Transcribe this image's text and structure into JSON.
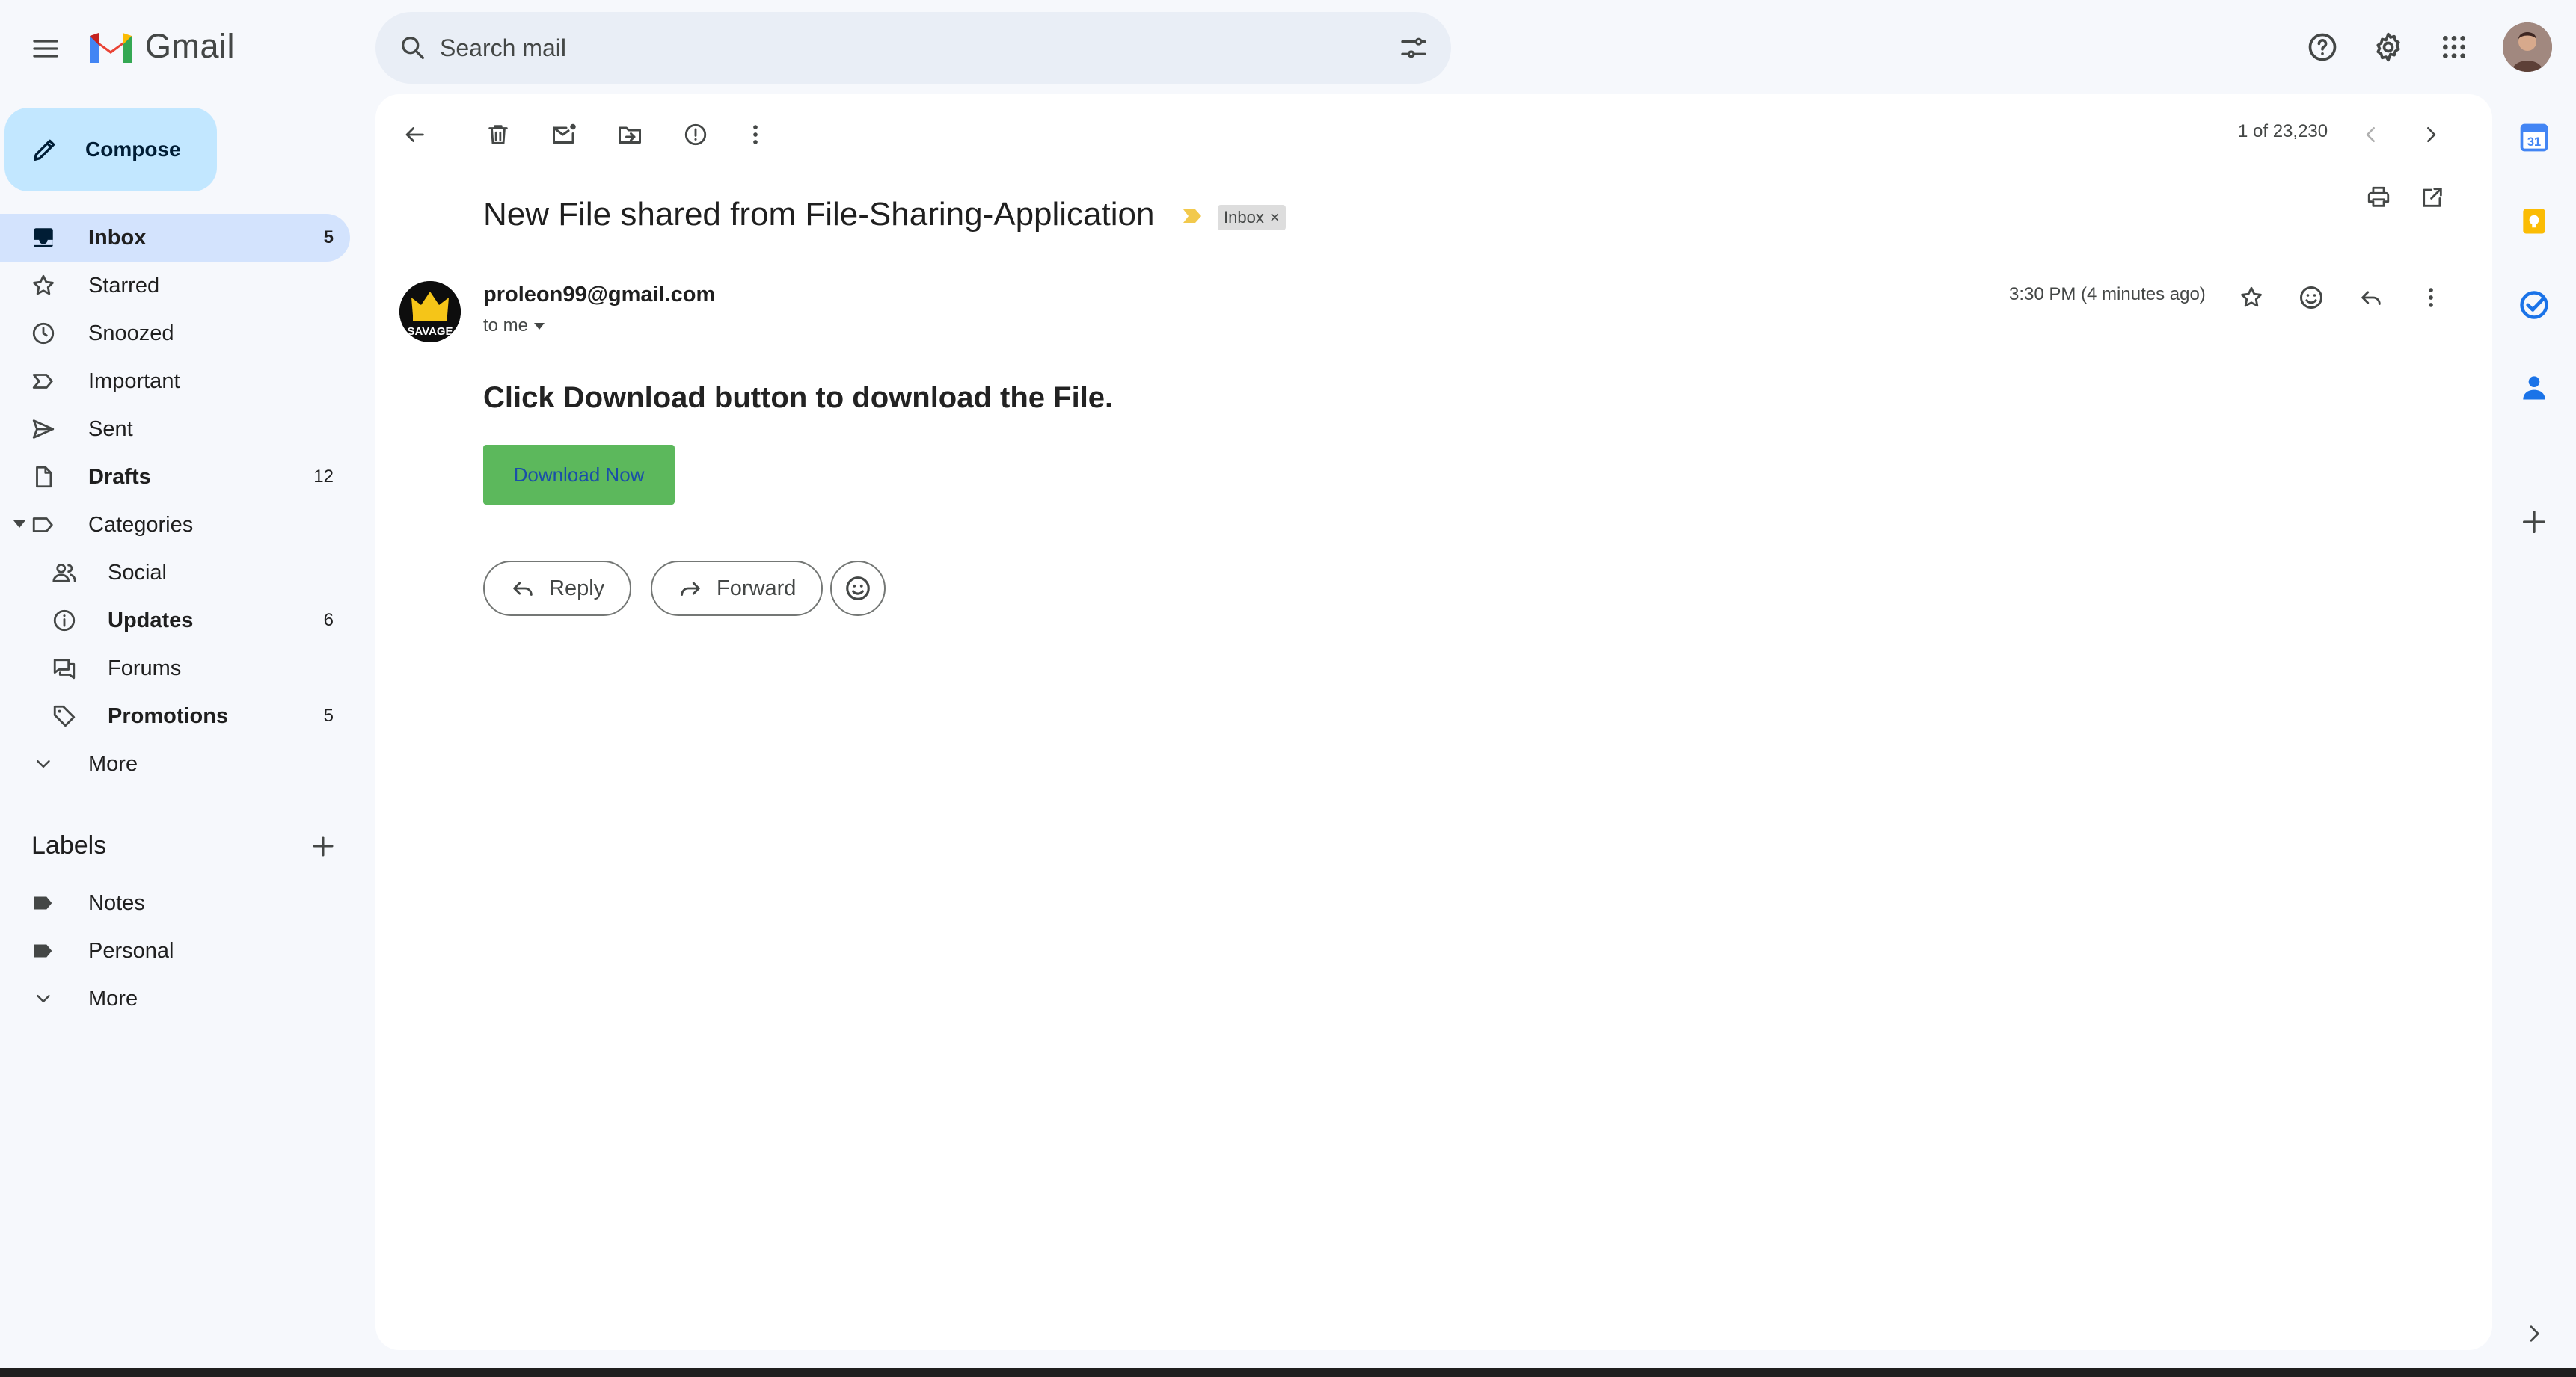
{
  "app": {
    "name": "Gmail"
  },
  "colors": {
    "accent": "#0b57d0",
    "compose_bg": "#c2e7ff",
    "active_nav": "#d3e3fd",
    "download_btn": "#5cb85c",
    "important_marker": "#f2c94c"
  },
  "search": {
    "placeholder": "Search mail"
  },
  "header_icons": [
    "help-icon",
    "settings-icon",
    "apps-icon"
  ],
  "compose": {
    "label": "Compose"
  },
  "nav": {
    "inbox": {
      "label": "Inbox",
      "count": "5"
    },
    "starred": {
      "label": "Starred"
    },
    "snoozed": {
      "label": "Snoozed"
    },
    "important": {
      "label": "Important"
    },
    "sent": {
      "label": "Sent"
    },
    "drafts": {
      "label": "Drafts",
      "count": "12"
    },
    "categories": {
      "label": "Categories"
    },
    "social": {
      "label": "Social"
    },
    "updates": {
      "label": "Updates",
      "count": "6"
    },
    "forums": {
      "label": "Forums"
    },
    "promotions": {
      "label": "Promotions",
      "count": "5"
    },
    "more": {
      "label": "More"
    }
  },
  "labels": {
    "title": "Labels",
    "items": [
      {
        "label": "Notes"
      },
      {
        "label": "Personal"
      }
    ],
    "more": "More"
  },
  "toolbar": {
    "pager": "1 of 23,230"
  },
  "email": {
    "subject": "New File shared from File-Sharing-Application",
    "chip": "Inbox",
    "chip_close": "×",
    "sender": "proleon99@gmail.com",
    "to": "to me",
    "time": "3:30 PM (4 minutes ago)",
    "heading": "Click Download button to download the File.",
    "download_label": "Download Now",
    "avatar_text": "SAVAGE"
  },
  "actions": {
    "reply": "Reply",
    "forward": "Forward"
  },
  "side_panel": {
    "calendar_day": "31",
    "icons": [
      "calendar-icon",
      "keep-icon",
      "tasks-icon",
      "contacts-icon",
      "add-addon-icon",
      "expand-panel-icon"
    ]
  }
}
